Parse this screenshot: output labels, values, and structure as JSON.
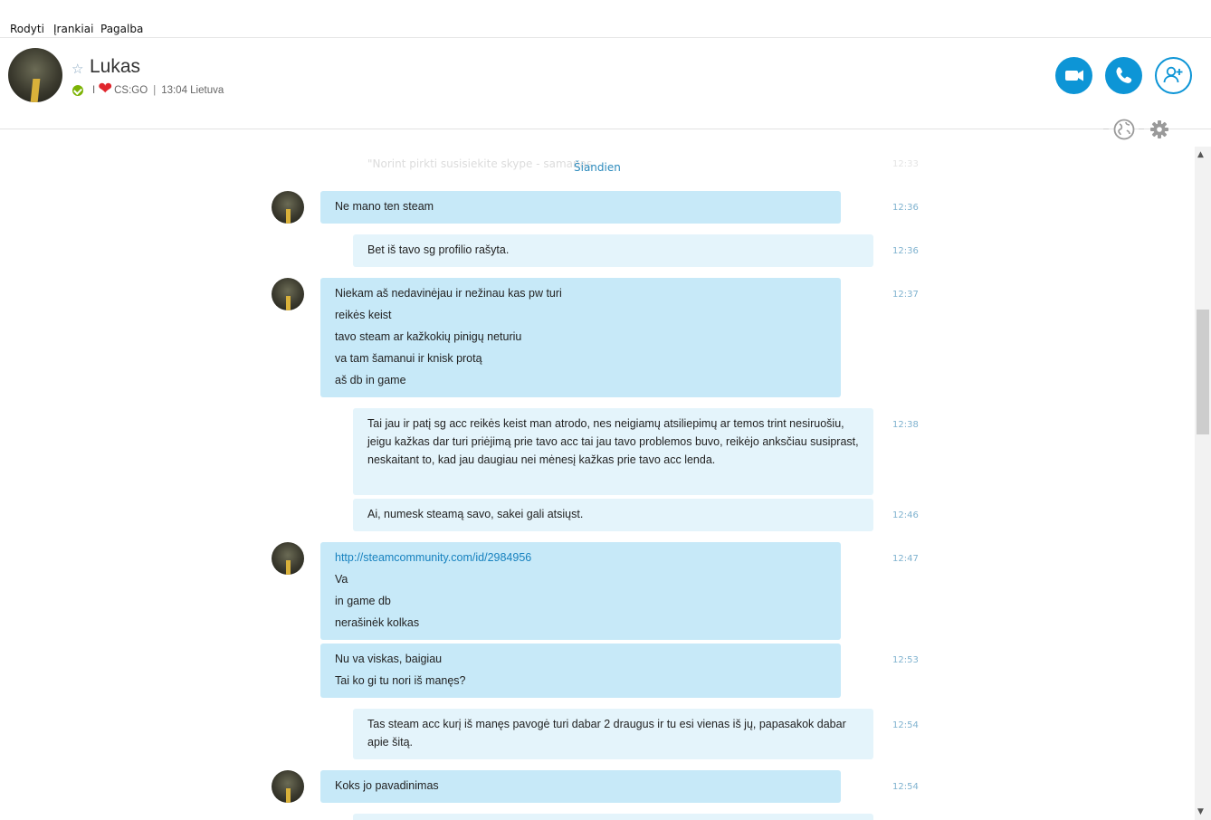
{
  "menu": [
    "Rodyti",
    "Įrankiai",
    "Pagalba"
  ],
  "contact": {
    "name": "Lukas",
    "mood_prefix": "I",
    "mood_text": "CS:GO",
    "local_time": "13:04 Lietuva"
  },
  "colors": {
    "accent": "#0d95d6",
    "incoming": "#c7e9f8",
    "outgoing": "#e4f4fb",
    "online": "#7cb305"
  },
  "conversation": {
    "ghost_text": "\"Norint pirkti susisiekite skype - samanas",
    "date_divider": "Šiandien",
    "messages": [
      {
        "dir": "in",
        "time": "12:36",
        "lines": [
          "Ne mano ten steam"
        ]
      },
      {
        "dir": "out",
        "time": "12:36",
        "lines": [
          "Bet iš tavo sg profilio rašyta."
        ]
      },
      {
        "dir": "in",
        "time": "12:37",
        "lines": [
          "Niekam aš nedavinėjau ir  nežinau kas pw turi",
          "reikės keist",
          "tavo steam ar kažkokių pinigų neturiu",
          "va tam šamanui ir knisk protą",
          "aš db in game"
        ]
      },
      {
        "dir": "out",
        "time": "12:38",
        "paragraph": "Tai jau ir patį sg acc reikės keist man atrodo, nes neigiamų atsiliepimų ar temos trint nesiruošiu, jeigu kažkas dar turi priėjimą prie tavo acc tai jau tavo problemos buvo, reikėjo anksčiau susiprast, neskaitant to, kad jau daugiau nei mėnesį kažkas prie tavo acc lenda."
      },
      {
        "dir": "out",
        "time": "12:46",
        "lines": [
          "Ai, numesk steamą savo, sakei gali atsiųst."
        ]
      },
      {
        "dir": "in",
        "time": "12:47",
        "link": "http://steamcommunity.com/id/2984956",
        "lines": [
          "Va",
          "in game db",
          "nerašinėk kolkas"
        ]
      },
      {
        "dir": "in",
        "time": "12:53",
        "lines": [
          "Nu va viskas, baigiau",
          "Tai ko gi tu nori iš manęs?"
        ]
      },
      {
        "dir": "out",
        "time": "12:54",
        "paragraph": "Tas steam acc kurį iš manęs pavogė turi dabar 2 draugus ir tu esi vienas iš jų, papasakok dabar apie šitą."
      },
      {
        "dir": "in",
        "time": "12:54",
        "lines": [
          "Koks jo pavadinimas"
        ]
      }
    ]
  }
}
